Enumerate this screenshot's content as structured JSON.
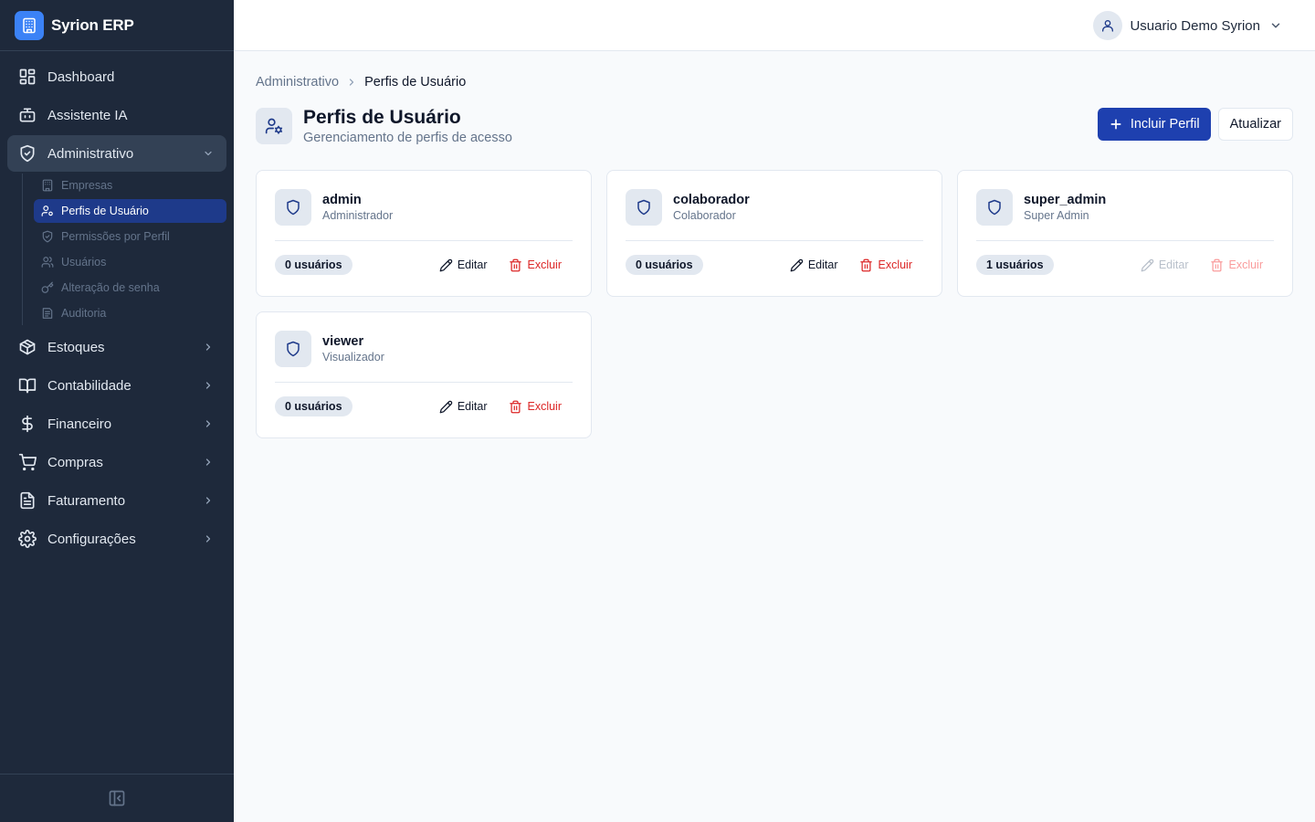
{
  "app": {
    "name": "Syrion ERP"
  },
  "sidebar": {
    "items": [
      {
        "label": "Dashboard",
        "icon": "dashboard-icon"
      },
      {
        "label": "Assistente IA",
        "icon": "bot-icon"
      },
      {
        "label": "Administrativo",
        "icon": "shield-check-icon",
        "expanded": true
      },
      {
        "label": "Estoques",
        "icon": "package-icon"
      },
      {
        "label": "Contabilidade",
        "icon": "book-icon"
      },
      {
        "label": "Financeiro",
        "icon": "dollar-icon"
      },
      {
        "label": "Compras",
        "icon": "cart-icon"
      },
      {
        "label": "Faturamento",
        "icon": "file-text-icon"
      },
      {
        "label": "Configurações",
        "icon": "gear-icon"
      }
    ],
    "admin_subitems": [
      {
        "label": "Empresas",
        "icon": "building-icon"
      },
      {
        "label": "Perfis de Usuário",
        "icon": "user-cog-icon",
        "current": true
      },
      {
        "label": "Permissões por Perfil",
        "icon": "shield-check-icon"
      },
      {
        "label": "Usuários",
        "icon": "users-icon"
      },
      {
        "label": "Alteração de senha",
        "icon": "key-icon"
      },
      {
        "label": "Auditoria",
        "icon": "audit-icon"
      }
    ]
  },
  "header": {
    "user_name": "Usuario Demo Syrion"
  },
  "breadcrumb": {
    "parent": "Administrativo",
    "current": "Perfis de Usuário"
  },
  "page": {
    "title": "Perfis de Usuário",
    "subtitle": "Gerenciamento de perfis de acesso",
    "add_button": "Incluir Perfil",
    "refresh_button": "Atualizar"
  },
  "profiles": [
    {
      "name": "admin",
      "description": "Administrador",
      "users": "0 usuários",
      "edit": "Editar",
      "delete": "Excluir",
      "actions_enabled": true
    },
    {
      "name": "colaborador",
      "description": "Colaborador",
      "users": "0 usuários",
      "edit": "Editar",
      "delete": "Excluir",
      "actions_enabled": true
    },
    {
      "name": "super_admin",
      "description": "Super Admin",
      "users": "1 usuários",
      "edit": "Editar",
      "delete": "Excluir",
      "actions_enabled": false
    },
    {
      "name": "viewer",
      "description": "Visualizador",
      "users": "0 usuários",
      "edit": "Editar",
      "delete": "Excluir",
      "actions_enabled": true
    }
  ],
  "colors": {
    "sidebar_bg": "#1e293b",
    "accent": "#1e40af",
    "danger": "#dc2626",
    "subitem_active": "#1e3a8a"
  }
}
